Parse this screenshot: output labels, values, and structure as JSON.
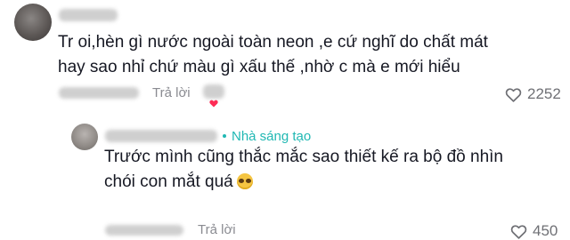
{
  "comment": {
    "line1": "Tr oi,hèn gì nước ngoài toàn neon ,e cứ nghĩ do chất mát",
    "line2": "hay sao nhỉ chứ màu gì xấu thế ,nhờ c mà e mới hiểu",
    "reply_label": "Trả lời",
    "likes": "2252"
  },
  "reply": {
    "creator_badge": "Nhà sáng tạo",
    "line1": "Trước mình cũng thắc mắc sao thiết kế ra bộ đồ nhìn",
    "line2": "chói con mắt quá",
    "reply_label": "Trả lời",
    "likes": "450"
  },
  "colors": {
    "creator_accent": "#20b8b3",
    "text": "#161823",
    "muted": "#8a8b91"
  },
  "icons": {
    "like": "heart-outline-icon",
    "creator_like": "red-heart-icon",
    "emoji": "grimacing-emoji-icon"
  }
}
